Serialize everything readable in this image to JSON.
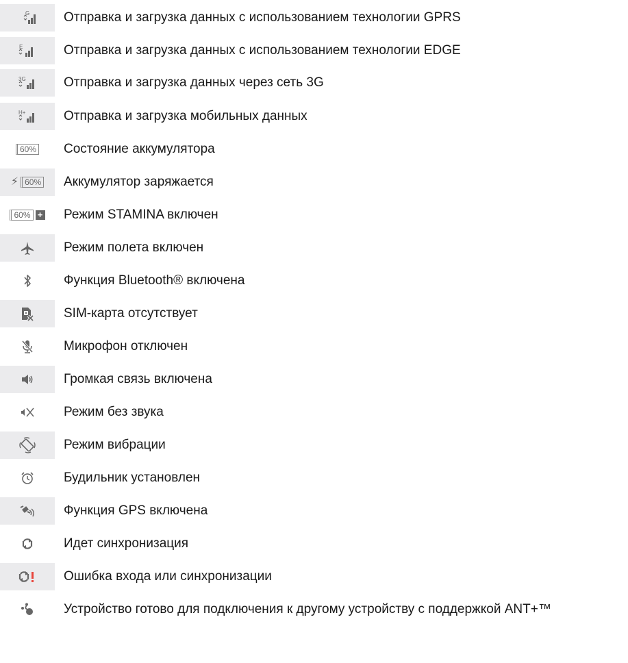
{
  "colors": {
    "icon_gray": "#666666",
    "icon_bg": "#ebebed",
    "text": "#1a1a1a",
    "error_red": "#e8453c"
  },
  "items": [
    {
      "icon": "gprs-signal-icon",
      "label": "Отправка и загрузка данных с использованием технологии GPRS"
    },
    {
      "icon": "edge-signal-icon",
      "label": "Отправка и загрузка данных с использованием технологии EDGE"
    },
    {
      "icon": "3g-signal-icon",
      "label": "Отправка и загрузка данных через сеть 3G"
    },
    {
      "icon": "hplus-signal-icon",
      "label": "Отправка и загрузка мобильных данных"
    },
    {
      "icon": "battery-icon",
      "label": "Состояние аккумулятора",
      "badge": "60%"
    },
    {
      "icon": "battery-charging-icon",
      "label": "Аккумулятор заряжается",
      "badge": "60%"
    },
    {
      "icon": "stamina-battery-icon",
      "label": "Режим STAMINA включен",
      "badge": "60%",
      "extra": "+"
    },
    {
      "icon": "airplane-icon",
      "label": "Режим полета включен"
    },
    {
      "icon": "bluetooth-icon",
      "label": "Функция Bluetooth® включена"
    },
    {
      "icon": "no-sim-icon",
      "label": "SIM-карта отсутствует"
    },
    {
      "icon": "mic-muted-icon",
      "label": "Микрофон отключен"
    },
    {
      "icon": "speaker-icon",
      "label": "Громкая связь включена"
    },
    {
      "icon": "silent-mode-icon",
      "label": "Режим без звука"
    },
    {
      "icon": "vibrate-icon",
      "label": "Режим вибрации"
    },
    {
      "icon": "alarm-icon",
      "label": "Будильник установлен"
    },
    {
      "icon": "gps-icon",
      "label": "Функция GPS включена"
    },
    {
      "icon": "sync-icon",
      "label": "Идет синхронизация"
    },
    {
      "icon": "sync-error-icon",
      "label": "Ошибка входа или синхронизации",
      "extra": "!"
    },
    {
      "icon": "ant-plus-icon",
      "label": "Устройство готово для подключения к другому устройству с поддержкой ANT+™"
    }
  ]
}
